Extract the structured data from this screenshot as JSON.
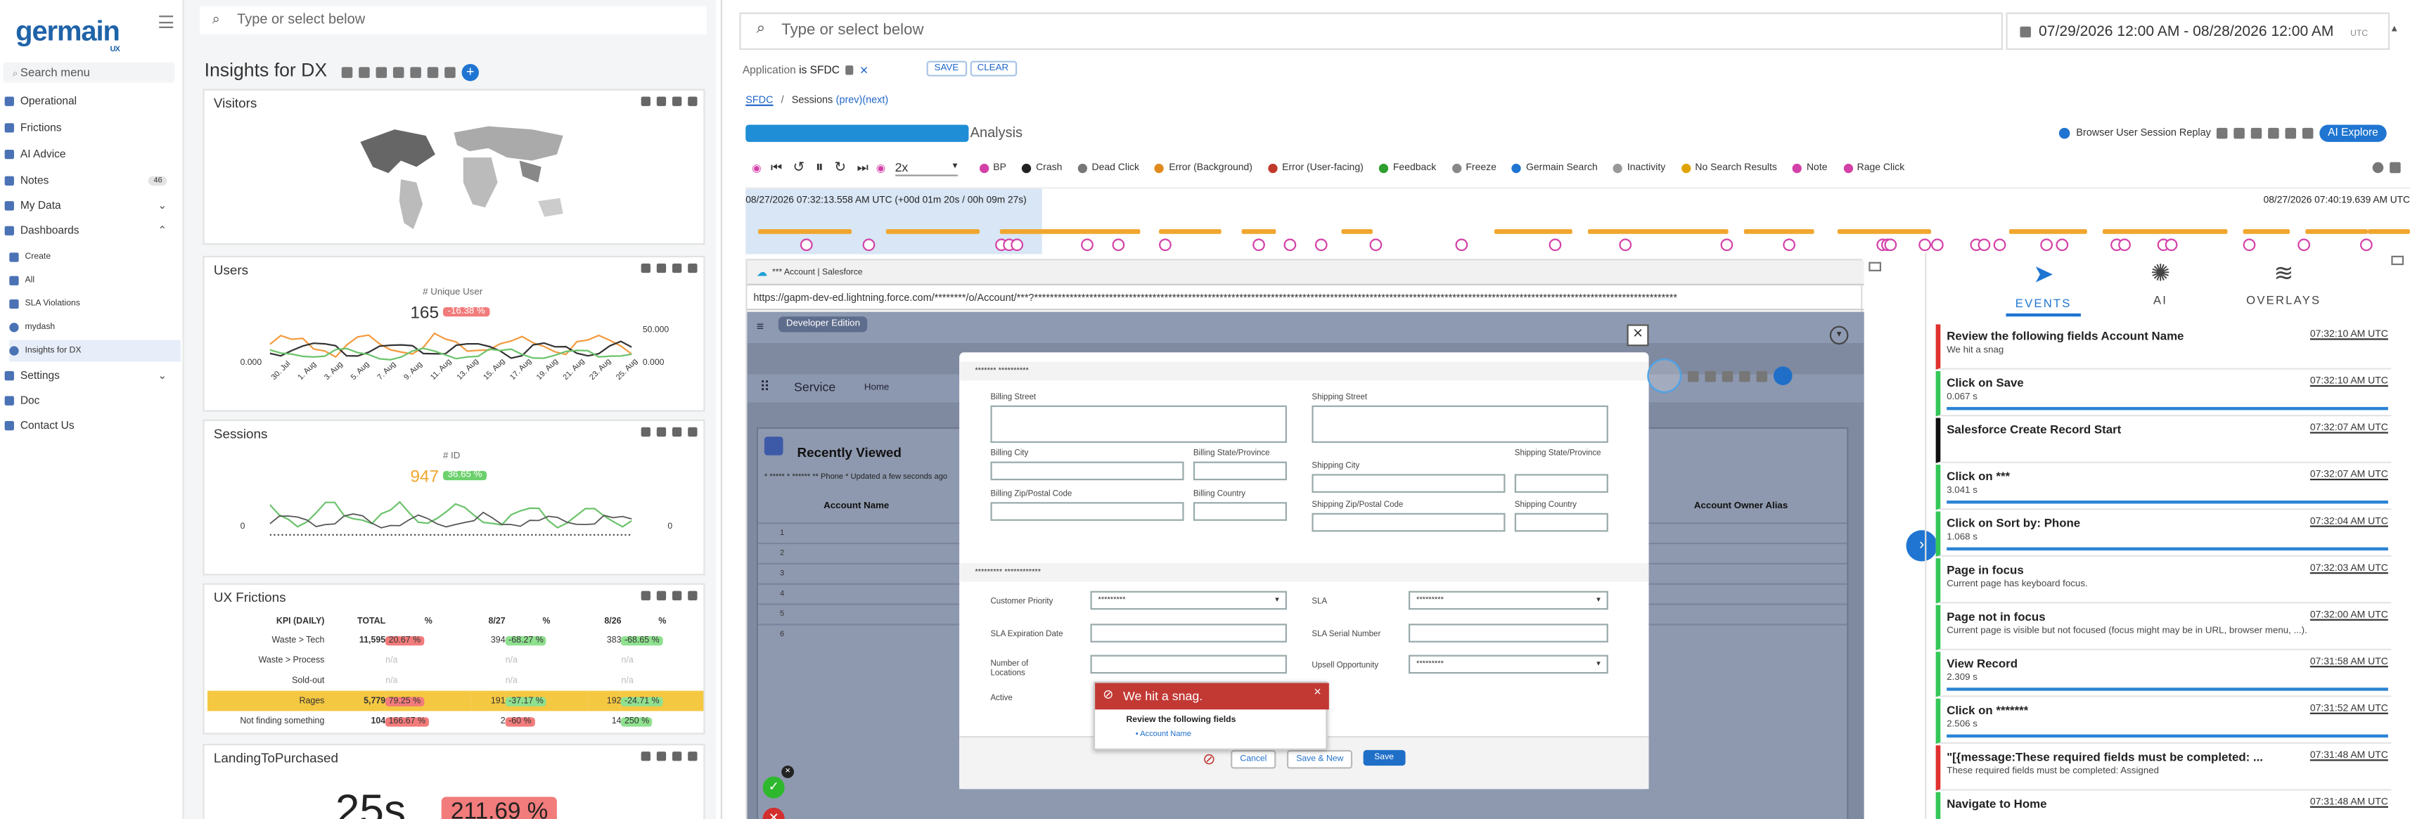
{
  "nav": {
    "logo": "germain",
    "logo_sub": "UX",
    "search": "Search menu",
    "items": [
      {
        "label": "Operational"
      },
      {
        "label": "Frictions"
      },
      {
        "label": "AI Advice"
      },
      {
        "label": "Notes",
        "badge": "46"
      },
      {
        "label": "My Data"
      },
      {
        "label": "Dashboards"
      },
      {
        "label": "Create"
      },
      {
        "label": "All"
      },
      {
        "label": "SLA Violations"
      },
      {
        "label": "mydash"
      },
      {
        "label": "Insights for DX"
      },
      {
        "label": "Settings"
      },
      {
        "label": "Doc"
      },
      {
        "label": "Contact Us"
      }
    ]
  },
  "dash": {
    "search_placeholder": "Type or select below",
    "title": "Insights for DX",
    "visitors": {
      "title": "Visitors"
    },
    "users": {
      "title": "Users",
      "metric_label": "# Unique User",
      "value": "165",
      "change": "-16.38 %",
      "y_left": "0.000",
      "y_right_top": "50.000",
      "y_right_bottom": "0.000",
      "x_ticks": [
        "30. Jul",
        "1. Aug",
        "3. Aug",
        "5. Aug",
        "7. Aug",
        "9. Aug",
        "11. Aug",
        "13. Aug",
        "15. Aug",
        "17. Aug",
        "19. Aug",
        "21. Aug",
        "23. Aug",
        "25. Aug"
      ]
    },
    "sessions": {
      "title": "Sessions",
      "metric_label": "# ID",
      "value": "947",
      "change": "36.65 %",
      "y_left": "0",
      "y_right": "0"
    },
    "frictions": {
      "title": "UX Frictions",
      "headers": [
        "KPI (DAILY)",
        "TOTAL",
        "%",
        "8/27",
        "%",
        "8/26",
        "%"
      ],
      "rows": [
        {
          "name": "Waste > Tech",
          "total": "11,595",
          "pct": "20.67 %",
          "d1": "394",
          "p1": "-68.27 %",
          "d2": "383",
          "p2": "-68.65 %"
        },
        {
          "name": "Waste > Process",
          "total": "",
          "pct": "n/a",
          "d1": "",
          "p1": "n/a",
          "d2": "",
          "p2": "n/a"
        },
        {
          "name": "Sold-out",
          "total": "",
          "pct": "n/a",
          "d1": "",
          "p1": "n/a",
          "d2": "",
          "p2": "n/a"
        },
        {
          "name": "Rages",
          "total": "5,779",
          "pct": "79.25 %",
          "d1": "191",
          "p1": "-37.17 %",
          "d2": "192",
          "p2": "-24.71 %"
        },
        {
          "name": "Not finding something",
          "total": "104",
          "pct": "166.67 %",
          "d1": "2",
          "p1": "-60 %",
          "d2": "14",
          "p2": "250 %"
        }
      ]
    },
    "landing": {
      "title": "LandingToPurchased",
      "value": "25s",
      "change": "211.69 %"
    }
  },
  "replay": {
    "search_placeholder": "Type or select below",
    "date_range": "07/29/2026 12:00 AM - 08/28/2026 12:00 AM",
    "tz": "UTC",
    "filter": {
      "field": "Application",
      "op": "is",
      "value": "SFDC"
    },
    "save": "SAVE",
    "clear": "CLEAR",
    "breadcrumb": {
      "root": "SFDC",
      "sep": "/",
      "sessions": "Sessions",
      "prev": "(prev)",
      "next": "(next)"
    },
    "title": "Analysis",
    "view_btn": "Browser User Session Replay",
    "ai_btn": "AI Explore",
    "speed": "2x",
    "toolbar": [
      "BP",
      "Crash",
      "Dead Click",
      "Error (Background)",
      "Error (User-facing)",
      "Feedback",
      "Freeze",
      "Germain Search",
      "Inactivity",
      "No Search Results",
      "Note",
      "Rage Click"
    ],
    "time_start": "08/27/2026 07:32:13.558 AM UTC (+00d 01m 20s / 00h 09m 27s)",
    "time_end": "08/27/2026 07:40:19.639 AM UTC",
    "browser": {
      "tab": "*** Account | Salesforce",
      "url": "https://gapm-dev-ed.lightning.force.com/********/o/Account/***?*******************************************************************************************************************************************************************"
    },
    "sf": {
      "edition": "Developer Edition",
      "app": "Service",
      "nav_home": "Home",
      "list_title": "Recently Viewed",
      "list_sub": "* ***** * ****** ** Phone * Updated a few seconds ago",
      "col_name": "Account Name",
      "col_owner": "Account Owner Alias",
      "rows": [
        "1",
        "2",
        "3",
        "4",
        "5",
        "6"
      ],
      "modal": {
        "section1": "******* **********",
        "billing_street": "Billing Street",
        "shipping_street": "Shipping Street",
        "billing_city": "Billing City",
        "billing_state": "Billing State/Province",
        "shipping_city": "Shipping City",
        "shipping_state": "Shipping State/Province",
        "billing_zip": "Billing Zip/Postal Code",
        "billing_country": "Billing Country",
        "shipping_zip": "Shipping Zip/Postal Code",
        "shipping_country": "Shipping Country",
        "section2": "********* ************",
        "priority": "Customer Priority",
        "priority_val": "*********",
        "sla": "SLA",
        "sla_val": "*********",
        "sla_exp": "SLA Expiration Date",
        "sla_serial": "SLA Serial Number",
        "locations": "Number of Locations",
        "upsell": "Upsell Opportunity",
        "upsell_val": "*********",
        "active": "Active",
        "cancel": "Cancel",
        "save_new": "Save & New",
        "save": "Save",
        "error_title": "We hit a snag.",
        "error_body": "Review the following fields",
        "error_field": "Account Name"
      }
    }
  },
  "panel": {
    "tabs": [
      "EVENTS",
      "AI",
      "OVERLAYS"
    ],
    "events": [
      {
        "title": "Review the following fields Account Name",
        "sub": "We hit a snag",
        "time": "07:32:10 AM UTC",
        "kind": "red",
        "bar": false
      },
      {
        "title": "Click on Save",
        "sub": "0.067 s",
        "time": "07:32:10 AM UTC",
        "kind": "green",
        "bar": true
      },
      {
        "title": "Salesforce Create Record Start",
        "sub": "",
        "time": "07:32:07 AM UTC",
        "kind": "blk",
        "bar": false
      },
      {
        "title": "Click on ***",
        "sub": "3.041 s",
        "time": "07:32:07 AM UTC",
        "kind": "green",
        "bar": true
      },
      {
        "title": "Click on Sort by: Phone",
        "sub": "1.068 s",
        "time": "07:32:04 AM UTC",
        "kind": "green",
        "bar": true
      },
      {
        "title": "Page in focus",
        "sub": "Current page has keyboard focus.",
        "time": "07:32:03 AM UTC",
        "kind": "green",
        "bar": false
      },
      {
        "title": "Page not in focus",
        "sub": "Current page is visible but not focused (focus might may be in URL, browser menu, ...).",
        "time": "07:32:00 AM UTC",
        "kind": "green",
        "bar": false
      },
      {
        "title": "View Record",
        "sub": "2.309 s",
        "time": "07:31:58 AM UTC",
        "kind": "green",
        "bar": true
      },
      {
        "title": "Click on *******",
        "sub": "2.506 s",
        "time": "07:31:52 AM UTC",
        "kind": "green",
        "bar": true
      },
      {
        "title": "\"[{message:These required fields must be completed: ...",
        "sub": "These required fields must be completed: Assigned",
        "time": "07:31:48 AM UTC",
        "kind": "red",
        "bar": false
      },
      {
        "title": "Navigate to Home",
        "sub": "",
        "time": "07:31:48 AM UTC",
        "kind": "green",
        "bar": false
      }
    ]
  }
}
